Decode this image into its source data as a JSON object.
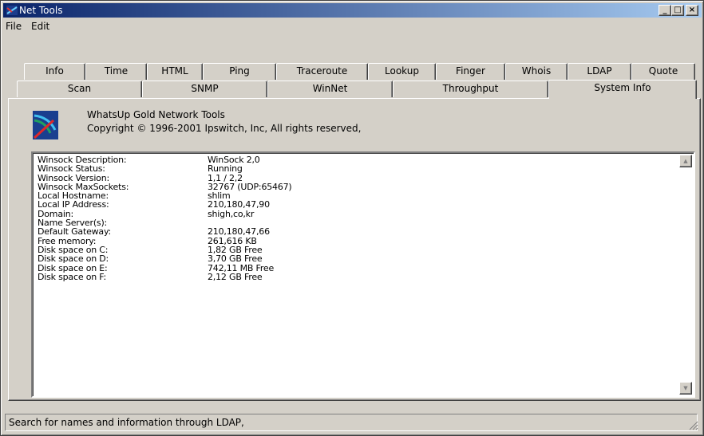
{
  "window": {
    "title": "Net Tools",
    "minimize_glyph": "_",
    "maximize_glyph": "□",
    "close_glyph": "×"
  },
  "menu": {
    "file": "File",
    "edit": "Edit"
  },
  "tabs": {
    "row1": [
      "Info",
      "Time",
      "HTML",
      "Ping",
      "Traceroute",
      "Lookup",
      "Finger",
      "Whois",
      "LDAP",
      "Quote"
    ],
    "row2": [
      "Scan",
      "SNMP",
      "WinNet",
      "Throughput",
      "System Info"
    ],
    "active": "System Info"
  },
  "about": {
    "line1": "WhatsUp Gold Network Tools",
    "line2": "Copyright © 1996-2001 Ipswitch, Inc, All rights reserved,"
  },
  "system_info": [
    {
      "label": "Winsock Description:",
      "value": "WinSock 2,0"
    },
    {
      "label": "Winsock Status:",
      "value": "Running"
    },
    {
      "label": "Winsock Version:",
      "value": "1,1 / 2,2"
    },
    {
      "label": "Winsock MaxSockets:",
      "value": "32767 (UDP:65467)"
    },
    {
      "label": "Local Hostname:",
      "value": "shlim"
    },
    {
      "label": "Local IP Address:",
      "value": "210,180,47,90"
    },
    {
      "label": "Domain:",
      "value": "shigh,co,kr"
    },
    {
      "label": "Name Server(s):",
      "value": ""
    },
    {
      "label": "Default Gateway:",
      "value": "210,180,47,66"
    },
    {
      "label": "Free memory:",
      "value": "261,616 KB"
    },
    {
      "label": "Disk space on C:",
      "value": "1,82 GB Free"
    },
    {
      "label": "Disk space on D:",
      "value": "3,70 GB Free"
    },
    {
      "label": "Disk space on E:",
      "value": "742,11 MB Free"
    },
    {
      "label": "Disk space on F:",
      "value": "2,12 GB Free"
    }
  ],
  "status": {
    "text": "Search for names and information through LDAP,"
  },
  "colors": {
    "titlebar_start": "#0a246a",
    "titlebar_end": "#a6caf0",
    "face": "#d4d0c8"
  }
}
